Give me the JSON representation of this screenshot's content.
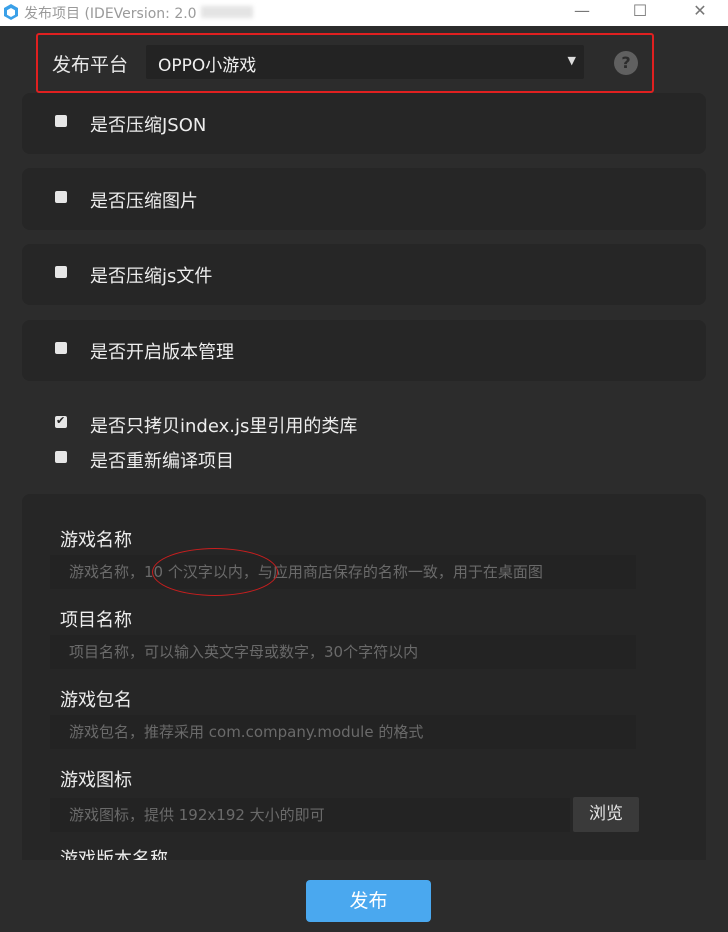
{
  "window": {
    "title": "发布项目 (IDEVersion: 2.0.0beta)",
    "visible_title": "发布项目 (IDEVersion: 2.0",
    "min_glyph": "—",
    "max_glyph": "☐",
    "close_glyph": "✕"
  },
  "platform": {
    "label": "发布平台",
    "selected": "OPPO小游戏",
    "caret": "▼",
    "help": "?"
  },
  "options": [
    {
      "label": "是否压缩JSON",
      "checked": false
    },
    {
      "label": "是否压缩图片",
      "checked": false
    },
    {
      "label": "是否压缩js文件",
      "checked": false
    },
    {
      "label": "是否开启版本管理",
      "checked": false
    },
    {
      "label": "是否只拷贝index.js里引用的类库",
      "checked": true
    },
    {
      "label": "是否重新编译项目",
      "checked": false
    }
  ],
  "form": {
    "game_name": {
      "label": "游戏名称",
      "placeholder": "游戏名称，10 个汉字以内，与应用商店保存的名称一致，用于在桌面图"
    },
    "project_name": {
      "label": "项目名称",
      "placeholder": "项目名称，可以输入英文字母或数字，30个字符以内"
    },
    "package_name": {
      "label": "游戏包名",
      "placeholder": "游戏包名，推荐采用 com.company.module 的格式"
    },
    "icon": {
      "label": "游戏图标",
      "placeholder": "游戏图标，提供 192x192 大小的即可",
      "browse": "浏览"
    },
    "version_name": {
      "label": "游戏版本名称"
    }
  },
  "publish_label": "发布",
  "colors": {
    "background": "#2c2c2c",
    "card": "#262626",
    "accent": "#4aa8ef",
    "highlight": "#e02020"
  },
  "icons": [
    "app-icon",
    "help-icon",
    "caret-down-icon",
    "check-icon"
  ]
}
